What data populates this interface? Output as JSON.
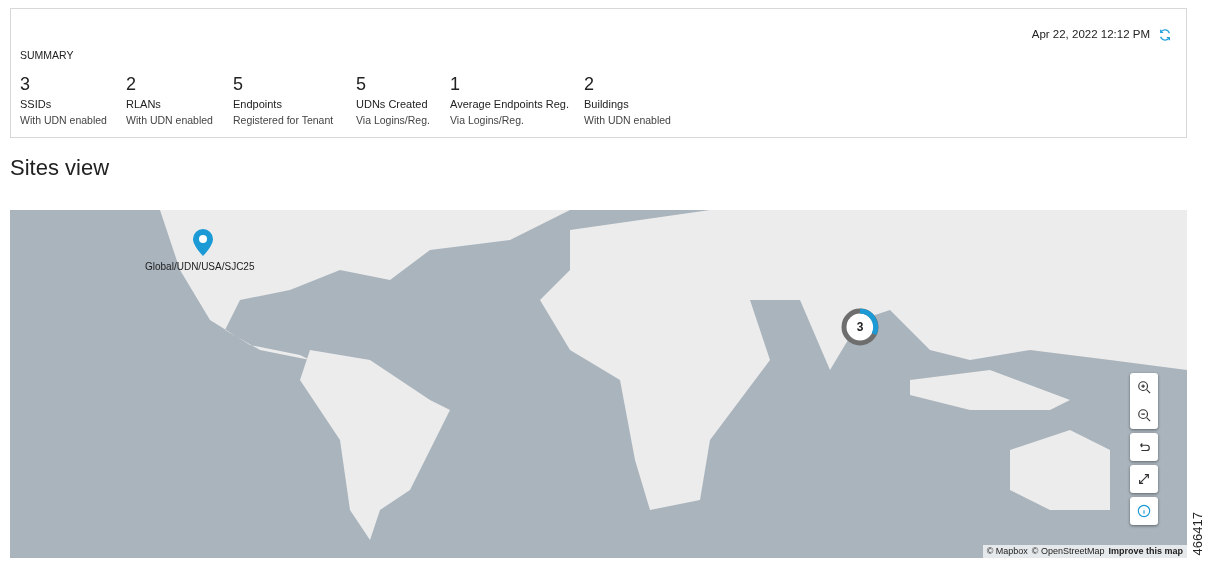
{
  "summary": {
    "timestamp": "Apr 22, 2022 12:12 PM",
    "title": "SUMMARY",
    "stats": [
      {
        "value": "3",
        "label": "SSIDs",
        "caption": "With UDN enabled"
      },
      {
        "value": "2",
        "label": "RLANs",
        "caption": "With UDN enabled"
      },
      {
        "value": "5",
        "label": "Endpoints",
        "caption": "Registered for Tenant"
      },
      {
        "value": "5",
        "label": "UDNs Created",
        "caption": "Via Logins/Reg."
      },
      {
        "value": "1",
        "label": "Average Endpoints Reg.",
        "caption": "Via Logins/Reg."
      },
      {
        "value": "2",
        "label": "Buildings",
        "caption": "With UDN enabled"
      }
    ]
  },
  "sites_view": {
    "title": "Sites view",
    "map": {
      "pin": {
        "label": "Global/UDN/USA/SJC25"
      },
      "cluster": {
        "count": "3"
      },
      "controls": [
        {
          "kind": "zoom_in"
        },
        {
          "kind": "zoom_out"
        },
        {
          "kind": "reset"
        },
        {
          "kind": "fullscreen"
        },
        {
          "kind": "info"
        }
      ],
      "attribution": [
        {
          "text": "© Mapbox",
          "bold": false
        },
        {
          "text": "© OpenStreetMap",
          "bold": false
        },
        {
          "text": "Improve this map",
          "bold": true
        }
      ]
    }
  },
  "figure_number": "466417"
}
